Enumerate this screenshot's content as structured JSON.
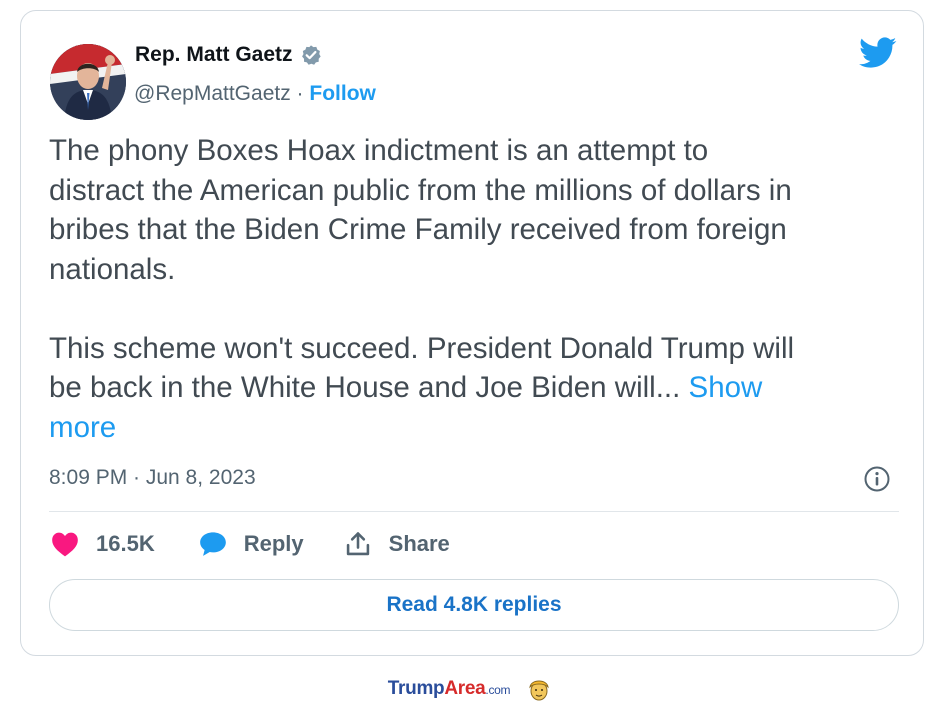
{
  "author": {
    "display_name": "Rep. Matt Gaetz",
    "handle": "@RepMattGaetz",
    "separator": " · ",
    "follow_label": "Follow"
  },
  "tweet": {
    "paragraph_1": "The phony Boxes Hoax indictment is an attempt to\ndistract the American public from the millions of dollars in\nbribes that the Biden Crime Family received from foreign\nnationals.",
    "paragraph_2": "This scheme won't succeed. President Donald Trump will\nbe back in the White House and Joe Biden will... ",
    "show_more_label": "Show\nmore",
    "timestamp": "8:09 PM · Jun 8, 2023"
  },
  "actions": {
    "likes_count": "16.5K",
    "reply_label": "Reply",
    "share_label": "Share",
    "read_replies_label": "Read 4.8K replies"
  },
  "footer": {
    "brand_part_1": "Trump",
    "brand_part_2": "Area",
    "brand_part_3": ".com"
  },
  "colors": {
    "accent": "#1d9bf0",
    "heart": "#f91880",
    "text": "#0f1419",
    "muted": "#536471",
    "brand_blue": "#2a4d9b",
    "brand_red": "#d62b2b"
  },
  "icons": [
    "avatar",
    "verified-badge-icon",
    "twitter-bird-icon",
    "info-icon",
    "heart-icon",
    "reply-bubble-icon",
    "share-icon",
    "mascot-icon"
  ]
}
